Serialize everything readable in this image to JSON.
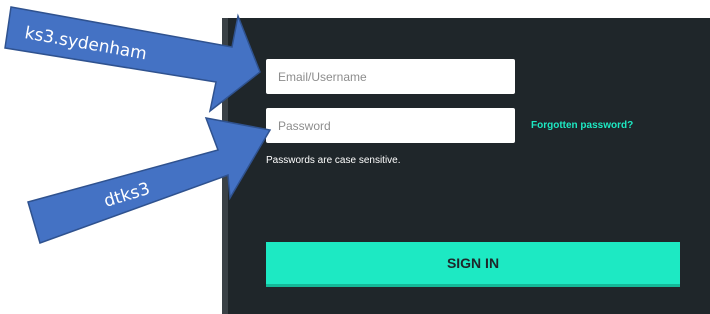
{
  "login": {
    "email_placeholder": "Email/Username",
    "password_placeholder": "Password",
    "forgot_password": "Forgotten password?",
    "case_hint": "Passwords are case sensitive.",
    "sign_in": "SIGN IN"
  },
  "annotations": [
    {
      "text": "ks3.sydenham",
      "points_to": "email-field"
    },
    {
      "text": "dtks3",
      "points_to": "password-field"
    }
  ],
  "colors": {
    "panel_bg": "#1f262a",
    "accent": "#1de9c3",
    "arrow_fill": "#4472c4"
  }
}
